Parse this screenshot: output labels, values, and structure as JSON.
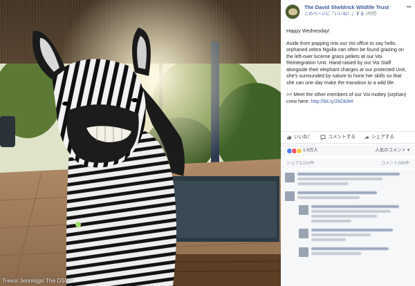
{
  "photo": {
    "credit": "Trevor Jennings/ The DSWT"
  },
  "post": {
    "page_name": "The David Sheldrick Wildlife Trust",
    "liked_label": "このページに「いいね！」する",
    "timestamp": "3時間",
    "greeting": "Happy Wednesday!",
    "body": "Aside from popping into our Voi office to say hello, orphaned zebra Ngulia can often be found grazing on the left-over lucerne grass pellets at our Voi Reintegration Unit. Hand-raised by our Voi Staff alongside their elephant charges at our protected Unit, she's surrounded by nature to hone her skills so that she can one day make the transition to a wild life.",
    "meet_text": ">> Meet the other members of our Voi motley (orphan) crew here:",
    "link": "http://bit.ly/2kOk9el"
  },
  "actions": {
    "like": "いいね！",
    "comment": "コメントする",
    "share": "シェアする"
  },
  "reactions": {
    "count": "1.6万人",
    "sort": "人気のコメント"
  },
  "stats": {
    "shares": "シェア3,154件",
    "comments": "コメント599件"
  },
  "colors": {
    "link": "#365899",
    "text": "#1d2129",
    "muted": "#90949c"
  }
}
